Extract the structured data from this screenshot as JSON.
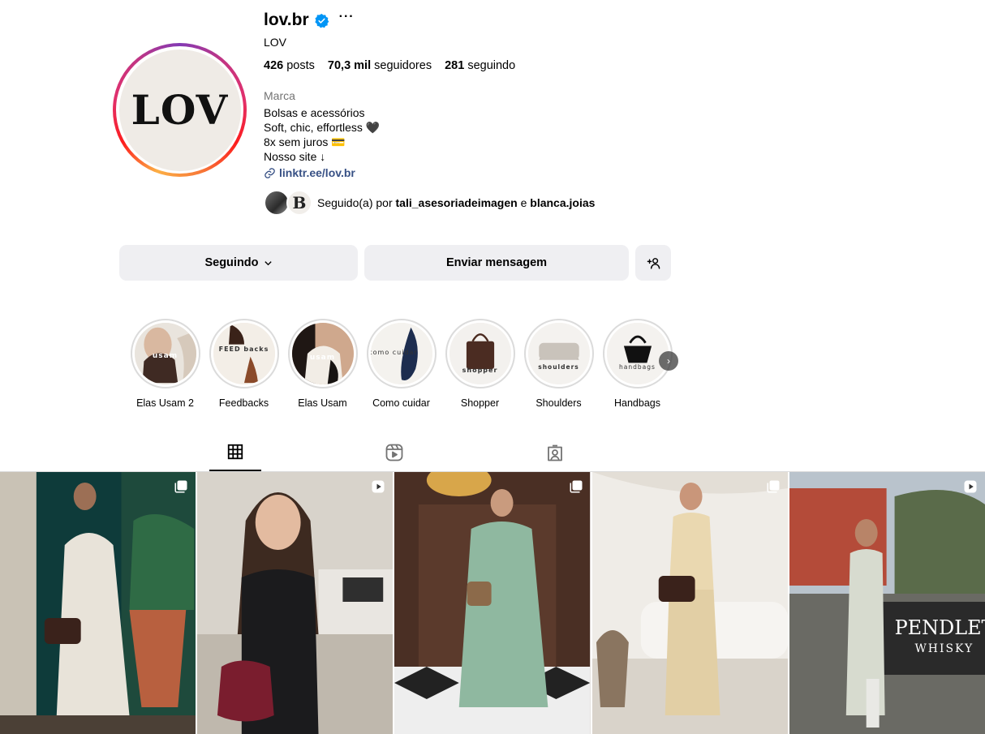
{
  "profile": {
    "username": "lov.br",
    "full_name": "LOV",
    "avatar_text": "LOV",
    "more_label": "···",
    "stats": {
      "posts_count": "426",
      "posts_label": "posts",
      "followers_count": "70,3 mil",
      "followers_label": "seguidores",
      "following_count": "281",
      "following_label": "seguindo"
    },
    "category": "Marca",
    "bio_lines": [
      "Bolsas e acessórios",
      "Soft, chic, effortless 🖤",
      "8x sem juros 💳",
      "Nosso site ↓"
    ],
    "link": "linktr.ee/lov.br",
    "followed_by": {
      "prefix": "Seguido(a) por",
      "user1": "tali_asesoriadeimagen",
      "conj": "e",
      "user2": "blanca.joias",
      "avatar2_letter": "B"
    }
  },
  "actions": {
    "following_label": "Seguindo",
    "message_label": "Enviar mensagem"
  },
  "highlights": [
    {
      "label": "Elas Usam 2",
      "word": "usam"
    },
    {
      "label": "Feedbacks",
      "word": "FEED backs"
    },
    {
      "label": "Elas Usam",
      "word": "usam"
    },
    {
      "label": "Como cuidar",
      "word": "como cuidar"
    },
    {
      "label": "Shopper",
      "word": "shopper"
    },
    {
      "label": "Shoulders",
      "word": "shoulders"
    },
    {
      "label": "Handbags",
      "word": "handbags"
    }
  ],
  "tabs": [
    "grid-icon",
    "reels-icon",
    "tagged-icon"
  ],
  "posts": [
    {
      "type": "carousel",
      "overlay_text": ""
    },
    {
      "type": "reel",
      "overlay_text": ""
    },
    {
      "type": "carousel",
      "overlay_text": ""
    },
    {
      "type": "carousel",
      "overlay_text": ""
    },
    {
      "type": "reel",
      "overlay_text": "PENDLETON WHISKY"
    }
  ],
  "colors": {
    "link": "#385185",
    "verified": "#0095f6",
    "button_bg": "#efeff2"
  }
}
